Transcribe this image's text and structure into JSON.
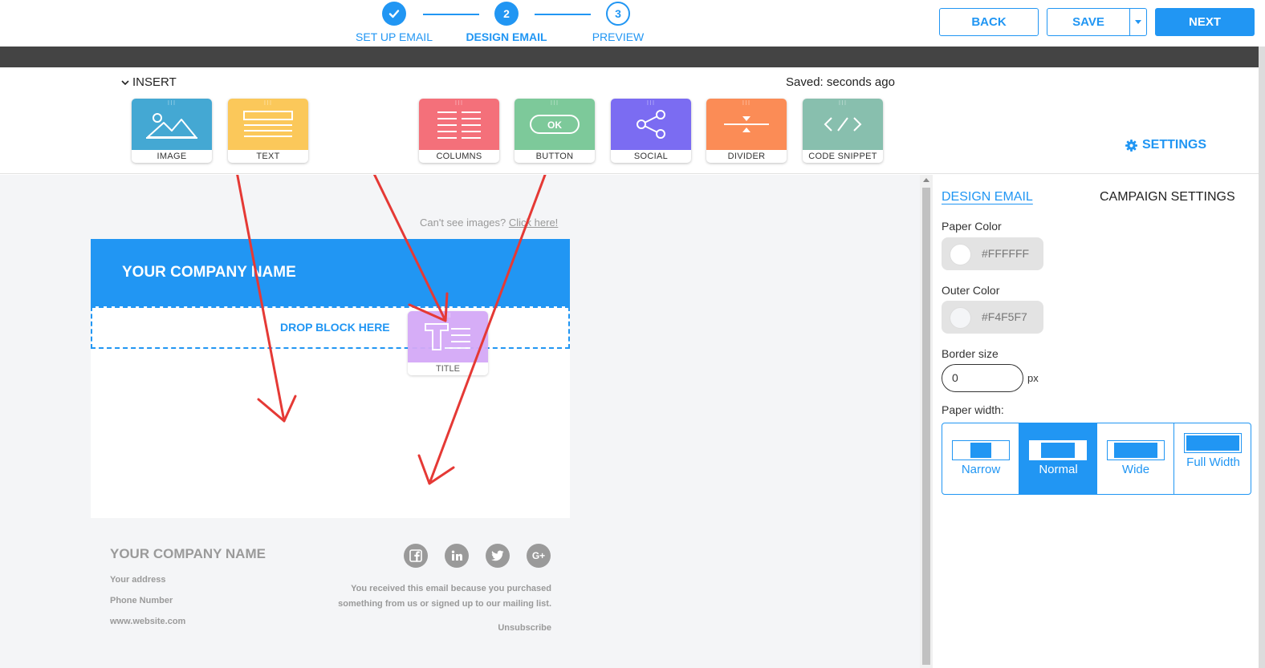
{
  "steps": [
    {
      "number": "",
      "label": "SET UP EMAIL",
      "state": "done"
    },
    {
      "number": "2",
      "label": "DESIGN EMAIL",
      "state": "active"
    },
    {
      "number": "3",
      "label": "PREVIEW",
      "state": "todo"
    }
  ],
  "header": {
    "back_label": "BACK",
    "save_label": "SAVE",
    "next_label": "NEXT"
  },
  "insert": {
    "title": "INSERT",
    "saved_status": "Saved: seconds ago",
    "settings_label": "SETTINGS",
    "tiles": [
      {
        "label": "IMAGE",
        "color": "#44a8d3",
        "icon": "image-icon"
      },
      {
        "label": "TEXT",
        "color": "#fbc85a",
        "icon": "text-icon"
      },
      {
        "label": "COLUMNS",
        "color": "#f4707a",
        "icon": "columns-icon"
      },
      {
        "label": "BUTTON",
        "color": "#7dc99a",
        "icon": "button-icon"
      },
      {
        "label": "SOCIAL",
        "color": "#7b6cf2",
        "icon": "share-icon"
      },
      {
        "label": "DIVIDER",
        "color": "#fb8c56",
        "icon": "divider-icon"
      },
      {
        "label": "CODE SNIPPET",
        "color": "#88bfae",
        "icon": "code-icon"
      }
    ]
  },
  "email": {
    "cant_see_prefix": "Can't see images?",
    "cant_see_link": "Click here!",
    "header_title": "YOUR COMPANY NAME",
    "header_color": "#2196f3",
    "drop_label": "DROP BLOCK HERE",
    "dragging_tile": {
      "label": "TITLE",
      "color": "#d4a9f7",
      "icon": "title-icon"
    },
    "footer": {
      "company": "YOUR COMPANY NAME",
      "address": "Your address",
      "phone": "Phone Number",
      "website": "www.website.com",
      "notice_line1": "You received this email because you purchased",
      "notice_line2": "something from us or signed up to our mailing list.",
      "unsubscribe": "Unsubscribe",
      "social_icons": [
        "facebook-icon",
        "linkedin-icon",
        "twitter-icon",
        "google-plus-icon"
      ]
    }
  },
  "panel": {
    "tab_design": "DESIGN EMAIL",
    "tab_campaign": "CAMPAIGN SETTINGS",
    "paper_color_label": "Paper Color",
    "paper_color_value": "#FFFFFF",
    "outer_color_label": "Outer Color",
    "outer_color_value": "#F4F5F7",
    "border_size_label": "Border size",
    "border_size_value": "0",
    "border_unit": "px",
    "paper_width_label": "Paper width:",
    "width_options": [
      {
        "label": "Narrow",
        "selected": false
      },
      {
        "label": "Normal",
        "selected": true
      },
      {
        "label": "Wide",
        "selected": false
      },
      {
        "label": "Full Width",
        "selected": false
      }
    ]
  }
}
